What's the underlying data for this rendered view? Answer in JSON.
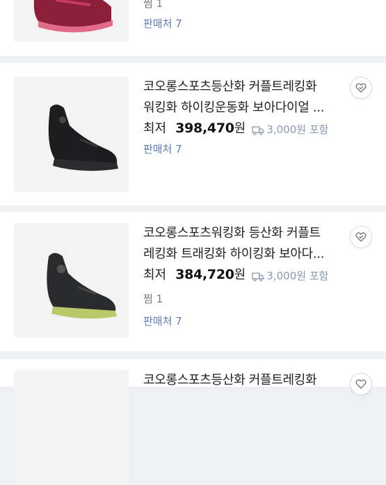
{
  "items": [
    {
      "like": "찜 1",
      "seller": "판매처 7"
    },
    {
      "title_line1": "코오롱스포츠등산화 커플트레킹화",
      "title_line2": "워킹화 하이킹운동화 보아다이얼 ...",
      "price_label": "최저",
      "price": "398,470",
      "currency": "원",
      "shipping": "3,000원 포함",
      "seller": "판매처 7"
    },
    {
      "title_line1": "코오롱스포츠워킹화 등산화 커플트",
      "title_line2": "레킹화 트래킹화 하이킹화 보아다...",
      "price_label": "최저",
      "price": "384,720",
      "currency": "원",
      "shipping": "3,000원 포함",
      "like": "찜 1",
      "seller": "판매처 7"
    },
    {
      "title_line1": "코오롱스포츠등산화 커플트레킹화"
    }
  ],
  "icons": {
    "wishlist": "heart-icon",
    "shipping": "truck-icon"
  },
  "colors": {
    "background": "#eef0f3",
    "card": "#ffffff",
    "seller_link": "#5d7cc0",
    "shipping_text": "#8a97b3"
  }
}
